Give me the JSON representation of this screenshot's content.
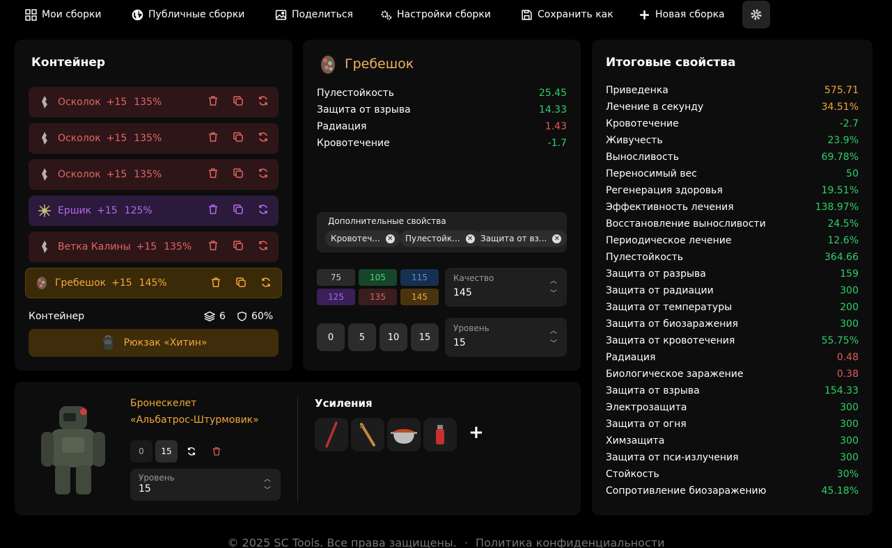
{
  "nav": {
    "my_builds": "Мои сборки",
    "public_builds": "Публичные сборки",
    "share": "Поделиться",
    "build_settings": "Настройки сборки",
    "save_as": "Сохранить как",
    "new_build": "Новая сборка",
    "settings_icon": "gear-icon"
  },
  "container": {
    "title": "Контейнер",
    "artifacts": [
      {
        "name": "Осколок",
        "level": "+15",
        "percent": "135%",
        "rarity": "red"
      },
      {
        "name": "Осколок",
        "level": "+15",
        "percent": "135%",
        "rarity": "red"
      },
      {
        "name": "Осколок",
        "level": "+15",
        "percent": "135%",
        "rarity": "red"
      },
      {
        "name": "Ершик",
        "level": "+15",
        "percent": "125%",
        "rarity": "purple"
      },
      {
        "name": "Ветка Калины",
        "level": "+15",
        "percent": "135%",
        "rarity": "red"
      },
      {
        "name": "Гребешок",
        "level": "+15",
        "percent": "145%",
        "rarity": "orange"
      }
    ],
    "footer_label": "Контейнер",
    "slots": "6",
    "protection": "60%",
    "backpack": "Рюкзак «Хитин»"
  },
  "artifact": {
    "name": "Гребешок",
    "properties": [
      {
        "label": "Пулестойкость",
        "value": "25.45",
        "color": "green"
      },
      {
        "label": "Защита от взрыва",
        "value": "14.33",
        "color": "green"
      },
      {
        "label": "Радиация",
        "value": "1.43",
        "color": "red"
      },
      {
        "label": "Кровотечение",
        "value": "-1.7",
        "color": "green"
      }
    ],
    "extra_label": "Дополнительные свойства",
    "chips": [
      "Кровотеч...",
      "Пулестойк...",
      "Защита от вз..."
    ],
    "quality_buttons": [
      {
        "label": "75",
        "bg": "#2a2a2a",
        "fg": "#cccccc"
      },
      {
        "label": "105",
        "bg": "#15462a",
        "fg": "#4fd07e"
      },
      {
        "label": "115",
        "bg": "#17304f",
        "fg": "#5c8fd8"
      },
      {
        "label": "125",
        "bg": "#3a1f58",
        "fg": "#b06ae8"
      },
      {
        "label": "135",
        "bg": "#3a1d1f",
        "fg": "#d66767"
      },
      {
        "label": "145",
        "bg": "#4a3410",
        "fg": "#f2a93b"
      }
    ],
    "quality": {
      "label": "Качество",
      "value": "145"
    },
    "level_buttons": [
      "0",
      "5",
      "10",
      "15"
    ],
    "level": {
      "label": "Уровень",
      "value": "15"
    }
  },
  "armor": {
    "name_line1": "Бронескелет",
    "name_line2": "«Альбатрос-Штурмовик»",
    "buttons": [
      "0",
      "15"
    ],
    "level": {
      "label": "Уровень",
      "value": "15"
    },
    "boosts_title": "Усиления",
    "add_label": "+"
  },
  "summary": {
    "title": "Итоговые свойства",
    "rows": [
      {
        "label": "Приведенка",
        "value": "575.71",
        "color": "orange"
      },
      {
        "label": "Лечение в секунду",
        "value": "34.51%",
        "color": "orange"
      },
      {
        "label": "Кровотечение",
        "value": "-2.7",
        "color": "green"
      },
      {
        "label": "Живучесть",
        "value": "23.9%",
        "color": "green"
      },
      {
        "label": "Выносливость",
        "value": "69.78%",
        "color": "green"
      },
      {
        "label": "Переносимый вес",
        "value": "50",
        "color": "green"
      },
      {
        "label": "Регенерация здоровья",
        "value": "19.51%",
        "color": "green"
      },
      {
        "label": "Эффективность лечения",
        "value": "138.97%",
        "color": "green"
      },
      {
        "label": "Восстановление выносливости",
        "value": "24.5%",
        "color": "green"
      },
      {
        "label": "Периодическое лечение",
        "value": "12.6%",
        "color": "green"
      },
      {
        "label": "Пулестойкость",
        "value": "364.66",
        "color": "green"
      },
      {
        "label": "Защита от разрыва",
        "value": "159",
        "color": "green"
      },
      {
        "label": "Защита от радиации",
        "value": "300",
        "color": "green"
      },
      {
        "label": "Защита от температуры",
        "value": "200",
        "color": "green"
      },
      {
        "label": "Защита от биозаражения",
        "value": "300",
        "color": "green"
      },
      {
        "label": "Защита от кровотечения",
        "value": "55.75%",
        "color": "green"
      },
      {
        "label": "Радиация",
        "value": "0.48",
        "color": "red"
      },
      {
        "label": "Биологическое заражение",
        "value": "0.38",
        "color": "red"
      },
      {
        "label": "Защита от взрыва",
        "value": "154.33",
        "color": "green"
      },
      {
        "label": "Электрозащита",
        "value": "300",
        "color": "green"
      },
      {
        "label": "Защита от огня",
        "value": "300",
        "color": "green"
      },
      {
        "label": "Химзащита",
        "value": "300",
        "color": "green"
      },
      {
        "label": "Защита от пси-излучения",
        "value": "300",
        "color": "green"
      },
      {
        "label": "Стойкость",
        "value": "30%",
        "color": "green"
      },
      {
        "label": "Сопротивление биозаражению",
        "value": "45.18%",
        "color": "green"
      }
    ]
  },
  "footer": {
    "copyright": "© 2025 SC Tools. Все права защищены.",
    "separator": "·",
    "privacy": "Политика конфиденциальности"
  }
}
